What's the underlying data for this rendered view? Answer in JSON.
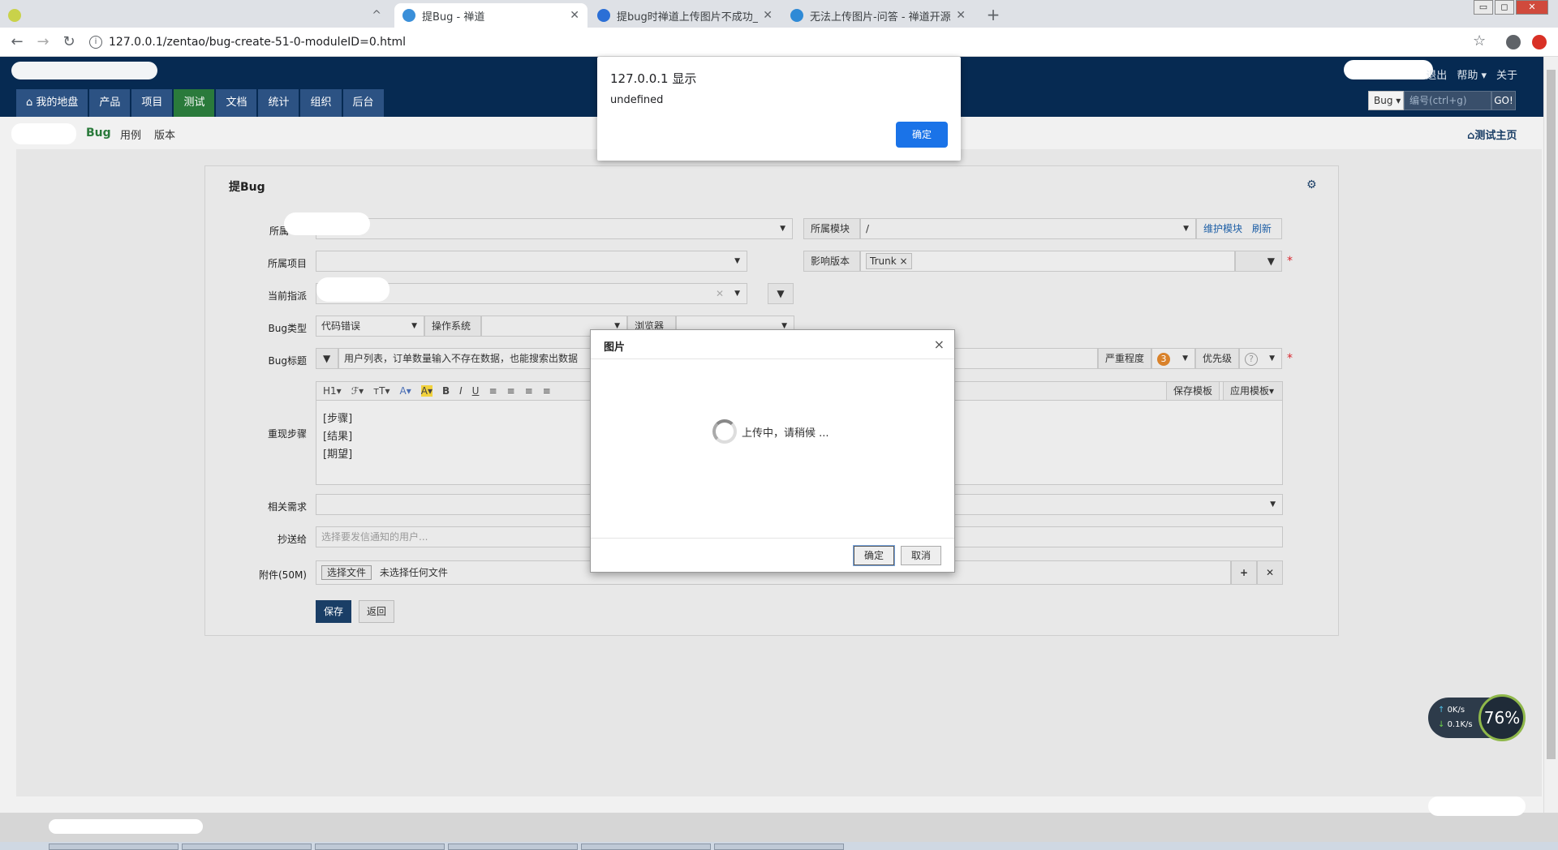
{
  "browser": {
    "tabs": [
      {
        "title": "",
        "active": false
      },
      {
        "title": "提Bug - 禅道",
        "active": true
      },
      {
        "title": "提bug时禅道上传图片不成功_百",
        "active": false
      },
      {
        "title": "无法上传图片-问答 - 禅道开源项",
        "active": false
      }
    ],
    "url": "127.0.0.1/zentao/bug-create-51-0-moduleID=0.html"
  },
  "header": {
    "nav": [
      "我的地盘",
      "产品",
      "项目",
      "测试",
      "文档",
      "统计",
      "组织",
      "后台"
    ],
    "active_nav": "测试",
    "top_links": [
      "退出",
      "帮助 ▾",
      "关于"
    ],
    "search_type": "Bug ▾",
    "search_placeholder": "编号(ctrl+g)",
    "search_go": "GO!"
  },
  "subnav": {
    "items": [
      "Bug",
      "用例",
      "版本"
    ],
    "home_link": "测试主页"
  },
  "form": {
    "title": "提Bug",
    "labels": {
      "product": "所属",
      "project": "所属项目",
      "assign": "当前指派",
      "bug_type": "Bug类型",
      "bug_title": "Bug标题",
      "steps": "重现步骤",
      "story": "相关需求",
      "mailto": "抄送给",
      "files": "附件(50M)"
    },
    "module_label": "所属模块",
    "module_value": "/",
    "maintain_module": "维护模块",
    "refresh": "刷新",
    "build_label": "影响版本",
    "build_value": "Trunk",
    "bug_type_value": "代码错误",
    "os_label": "操作系统",
    "browser_label": "浏览器",
    "title_value": "用户列表，订单数量输入不存在数据，也能搜索出数据",
    "severity_label": "严重程度",
    "severity_value": "3",
    "priority_label": "优先级",
    "priority_value": "?",
    "editor_tools": [
      "H1▾",
      "ℱ▾",
      "тT▾",
      "A▾",
      "A▾",
      "B",
      "I",
      "U",
      "≡",
      "≡",
      "≡",
      "≡"
    ],
    "save_template": "保存模板",
    "apply_template": "应用模板▾",
    "steps_lines": [
      "[步骤]",
      "[结果]",
      "[期望]"
    ],
    "mailto_placeholder": "选择要发信通知的用户...",
    "choose_file": "选择文件",
    "no_file": "未选择任何文件",
    "save_btn": "保存",
    "back_btn": "返回"
  },
  "alert": {
    "title": "127.0.0.1 显示",
    "message": "undefined",
    "ok": "确定"
  },
  "modal": {
    "title": "图片",
    "message": "上传中，请稍候 ...",
    "ok": "确定",
    "cancel": "取消"
  },
  "netwidget": {
    "up": "0K/s",
    "down": "0.1K/s",
    "percent": "76%"
  },
  "colors": {
    "header_bg": "#062a52",
    "active_nav": "#2a7a3b",
    "primary_btn": "#1a3e66",
    "chrome_blue": "#1a73e8"
  }
}
